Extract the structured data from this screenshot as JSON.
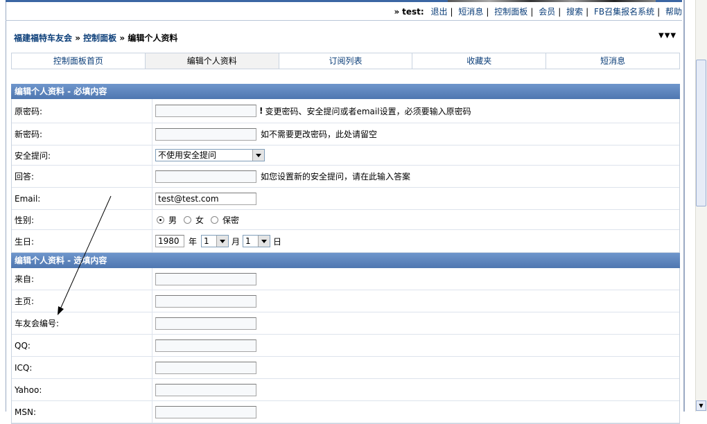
{
  "userbar": {
    "prefix": "»",
    "username": "test:",
    "links": [
      "退出",
      "短消息",
      "控制面板",
      "会员",
      "搜索",
      "FB召集报名系统",
      "帮助"
    ]
  },
  "breadcrumb": {
    "site": "福建福特车友会",
    "sep": "»",
    "panel": "控制面板",
    "current": "编辑个人资料"
  },
  "collapse_icon": "▼▼▼",
  "tabs": [
    "控制面板首页",
    "编辑个人资料",
    "订阅列表",
    "收藏夹",
    "短消息"
  ],
  "required": {
    "title": "编辑个人资料 - 必填内容",
    "old_password": {
      "label": "原密码:",
      "warn": "!",
      "hint": "变更密码、安全提问或者email设置，必须要输入原密码"
    },
    "new_password": {
      "label": "新密码:",
      "hint": "如不需要更改密码，此处请留空"
    },
    "question": {
      "label": "安全提问:",
      "value": "不使用安全提问"
    },
    "answer": {
      "label": "回答:",
      "hint": "如您设置新的安全提问，请在此输入答案"
    },
    "email": {
      "label": "Email:",
      "value": "test@test.com"
    },
    "gender": {
      "label": "性别:",
      "options": [
        "男",
        "女",
        "保密"
      ],
      "selected": "男"
    },
    "birthday": {
      "label": "生日:",
      "year": "1980",
      "year_unit": "年",
      "month": "1",
      "month_unit": "月",
      "day": "1",
      "day_unit": "日"
    }
  },
  "optional": {
    "title": "编辑个人资料 - 选填内容",
    "fields": [
      {
        "label": "来自:"
      },
      {
        "label": "主页:"
      },
      {
        "label": "车友会编号:"
      },
      {
        "label": "QQ:"
      },
      {
        "label": "ICQ:"
      },
      {
        "label": "Yahoo:"
      },
      {
        "label": "MSN:"
      }
    ]
  }
}
